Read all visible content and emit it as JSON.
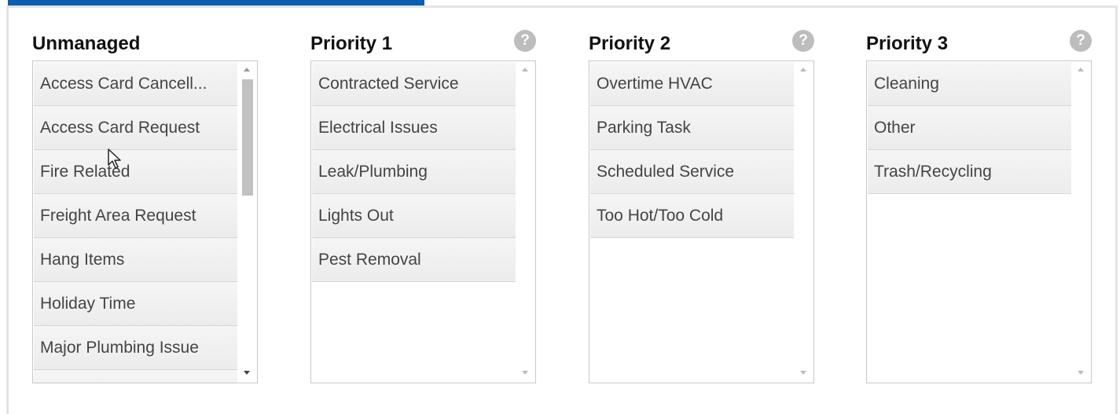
{
  "columns": [
    {
      "title": "Unmanaged",
      "has_help": false,
      "items": [
        "Access Card Cancell...",
        "Access Card Request",
        "Fire Related",
        "Freight Area Request",
        "Hang Items",
        "Holiday Time",
        "Major Plumbing Issue"
      ]
    },
    {
      "title": "Priority 1",
      "has_help": true,
      "help_glyph": "?",
      "items": [
        "Contracted Service",
        "Electrical Issues",
        "Leak/Plumbing",
        "Lights Out",
        "Pest Removal"
      ]
    },
    {
      "title": "Priority 2",
      "has_help": true,
      "help_glyph": "?",
      "items": [
        "Overtime HVAC",
        "Parking Task",
        "Scheduled Service",
        "Too Hot/Too Cold"
      ]
    },
    {
      "title": "Priority 3",
      "has_help": true,
      "help_glyph": "?",
      "items": [
        "Cleaning",
        "Other",
        "Trash/Recycling"
      ]
    }
  ],
  "colors": {
    "accent": "#0a5fb0",
    "help_icon": "#bdbdbd",
    "item_bg": "#efefef",
    "item_text": "#444444"
  }
}
